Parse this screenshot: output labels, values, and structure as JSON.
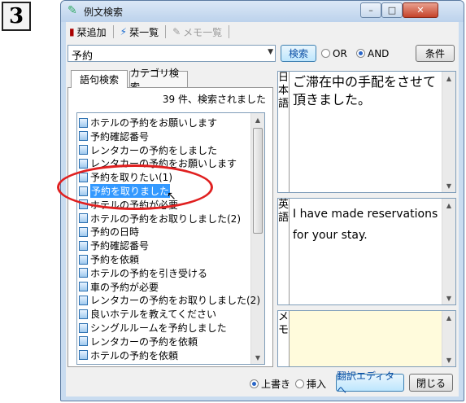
{
  "step_number": "3",
  "window": {
    "title": "例文検索",
    "controls": {
      "minimize": "–",
      "maximize": "□",
      "close": "✕"
    }
  },
  "toolbar": {
    "add_label": "栞追加",
    "bookmark_list_label": "栞一覧",
    "memo_list_label": "メモ一覧"
  },
  "search": {
    "query": "予約",
    "search_button": "検索",
    "or_label": "OR",
    "and_label": "AND",
    "selected_mode": "AND",
    "condition_button": "条件"
  },
  "tabs": [
    {
      "label": "語句検索",
      "active": true
    },
    {
      "label": "カテゴリ検索",
      "active": false
    }
  ],
  "result_count_text": "39 件、検索されました",
  "results": [
    "ホテルの予約をお願いします",
    "予約確認番号",
    "レンタカーの予約をしました",
    "レンタカーの予約をお願いします",
    "予約を取りたい(1)",
    "予約を取りました",
    "ホテルの予約が必要",
    "ホテルの予約をお取りしました(2)",
    "予約の日時",
    "予約確認番号",
    "予約を依頼",
    "ホテルの予約を引き受ける",
    "車の予約が必要",
    "レンタカーの予約をお取りしました(2)",
    "良いホテルを教えてください",
    "シングルルームを予約しました",
    "レンタカーの予約を依頼",
    "ホテルの予約を依頼"
  ],
  "selected_index": 5,
  "japanese_pane": {
    "label": "日本語",
    "text": "ご滞在中の手配をさせて頂きました。"
  },
  "english_pane": {
    "label": "英語",
    "text": "I have made reservations for your stay."
  },
  "memo_pane": {
    "label": "メモ",
    "text": ""
  },
  "bottom": {
    "overwrite_label": "上書き",
    "insert_label": "挿入",
    "selected_mode": "上書き",
    "translate_editor_button": "翻訳エディタへ",
    "close_button": "閉じる"
  },
  "colors": {
    "selection": "#3399ff",
    "annotation_ring": "#e02020",
    "memo_background": "#fffbdc"
  }
}
